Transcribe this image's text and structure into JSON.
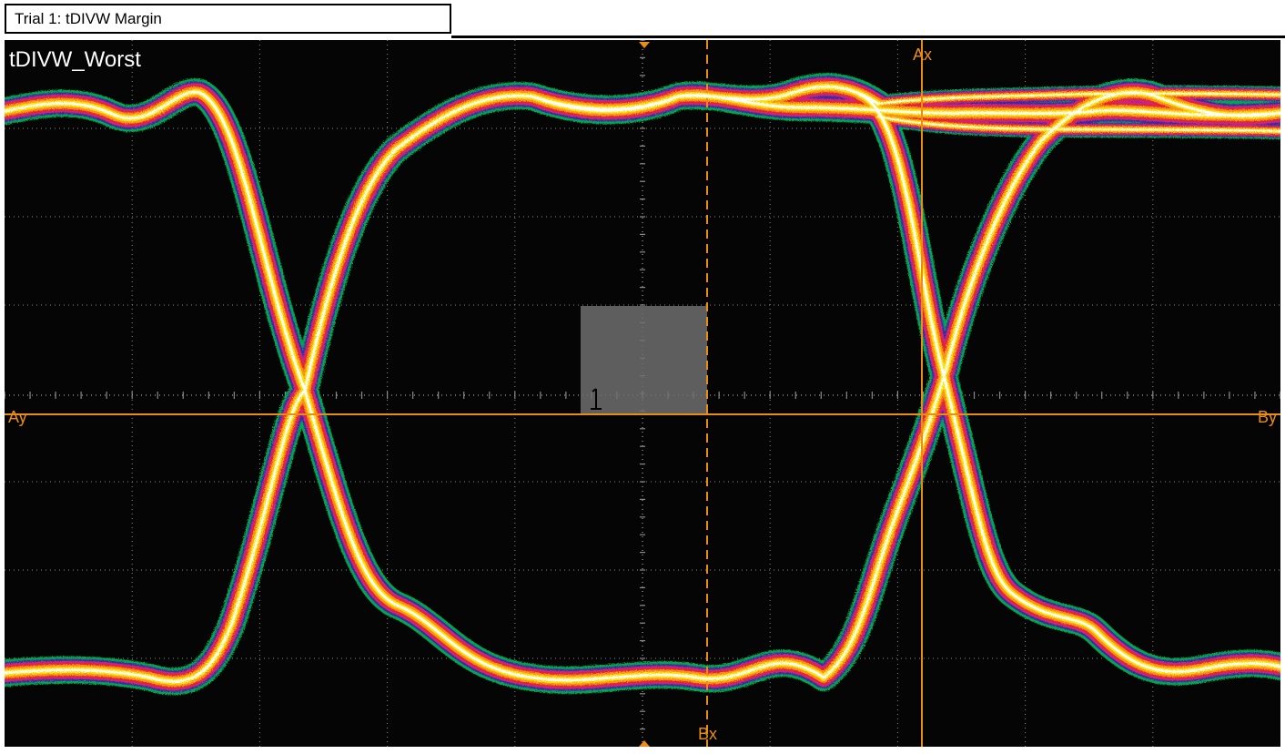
{
  "window": {
    "tab_title": "Trial 1: tDIVW Margin"
  },
  "waveform": {
    "title": "tDIVW_Worst"
  },
  "cursors": {
    "ax": "Ax",
    "bx": "Bx",
    "ay": "Ay",
    "by": "By"
  },
  "colors": {
    "background": "#050505",
    "grid": "#8a8a8a",
    "cursor": "#e98d14",
    "mask": "#6e6e6e",
    "persistence": [
      "#00a651",
      "#3a2a9c",
      "#c4288c",
      "#e8202a",
      "#f7931e",
      "#ffe000",
      "#ffffff"
    ]
  }
}
